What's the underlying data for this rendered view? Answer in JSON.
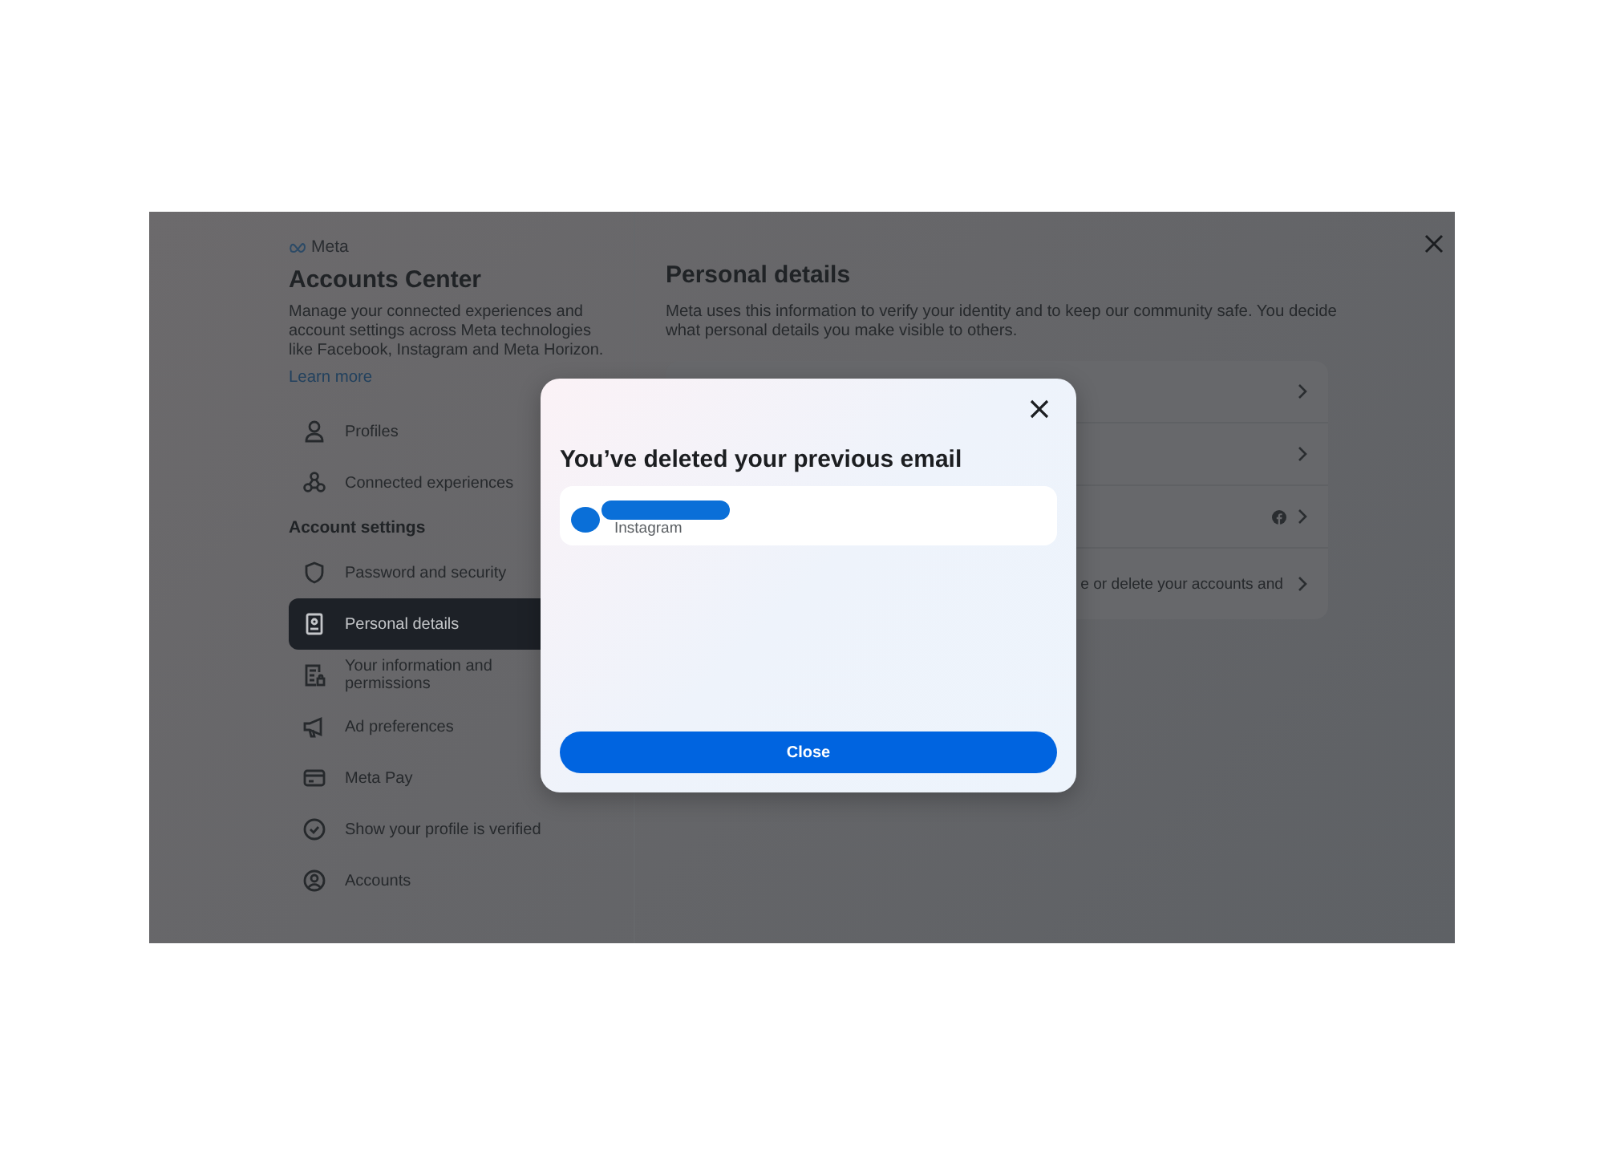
{
  "sidebar": {
    "brand": "Meta",
    "title": "Accounts Center",
    "description": "Manage your connected experiences and account settings across Meta technologies like Facebook, Instagram and Meta Horizon.",
    "link": "Learn more",
    "items": [
      {
        "kind": "item",
        "label": "Profiles",
        "selected": false
      },
      {
        "kind": "item",
        "label": "Connected experiences",
        "selected": false
      },
      {
        "kind": "heading",
        "label": "Account settings"
      },
      {
        "kind": "item",
        "label": "Password and security",
        "selected": false
      },
      {
        "kind": "item",
        "label": "Personal details",
        "selected": true
      },
      {
        "kind": "item",
        "label": "Your information and permissions",
        "selected": false
      },
      {
        "kind": "item",
        "label": "Ad preferences",
        "selected": false
      },
      {
        "kind": "item",
        "label": "Meta Pay",
        "selected": false
      },
      {
        "kind": "item",
        "label": "Show your profile is verified",
        "selected": false
      },
      {
        "kind": "item",
        "label": "Accounts",
        "selected": false
      }
    ]
  },
  "main": {
    "title": "Personal details",
    "description": "Meta uses this information to verify your identity and to keep our community safe. You decide what personal details you make visible to others.",
    "rows": [
      {
        "kind": "plain"
      },
      {
        "kind": "plain"
      },
      {
        "kind": "facebook"
      },
      {
        "kind": "text",
        "text": "e or delete your accounts and"
      }
    ]
  },
  "dialog": {
    "title": "You’ve deleted your previous email",
    "account": {
      "platform": "Instagram"
    },
    "button": "Close"
  }
}
